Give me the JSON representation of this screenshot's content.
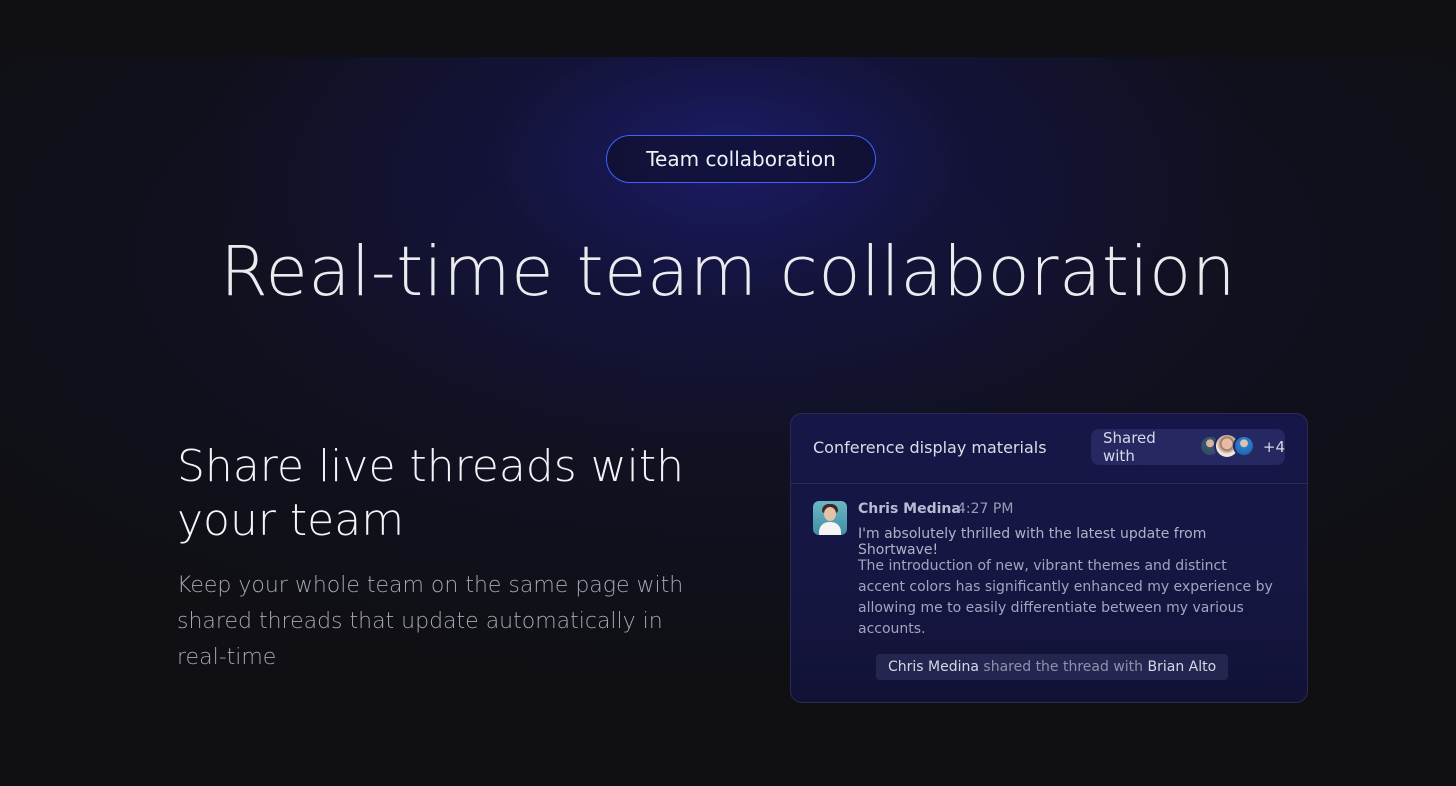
{
  "badge": {
    "label": "Team collaboration"
  },
  "hero": {
    "title": "Real-time team collaboration"
  },
  "feature": {
    "heading": "Share live threads with your team",
    "description": "Keep your whole team on the same page with shared threads that update automatically in real-time"
  },
  "card": {
    "title": "Conference display materials",
    "shared": {
      "label": "Shared with",
      "extra_count": "+4",
      "avatars": [
        "avatar-man",
        "avatar-woman",
        "avatar-person"
      ]
    },
    "message": {
      "author": "Chris Medina",
      "time": "4:27 PM",
      "line1": "I'm absolutely thrilled with the latest update from Shortwave!",
      "body": "The introduction of new, vibrant themes and distinct accent colors has significantly enhanced my experience by allowing me to easily differentiate between my various accounts."
    },
    "share_note": {
      "actor": "Chris Medina",
      "action": " shared the thread with ",
      "target": "Brian Alto"
    }
  },
  "colors": {
    "accent_border": "#3d63ff",
    "background": "#0f0f14",
    "card_bg": "#161748"
  }
}
